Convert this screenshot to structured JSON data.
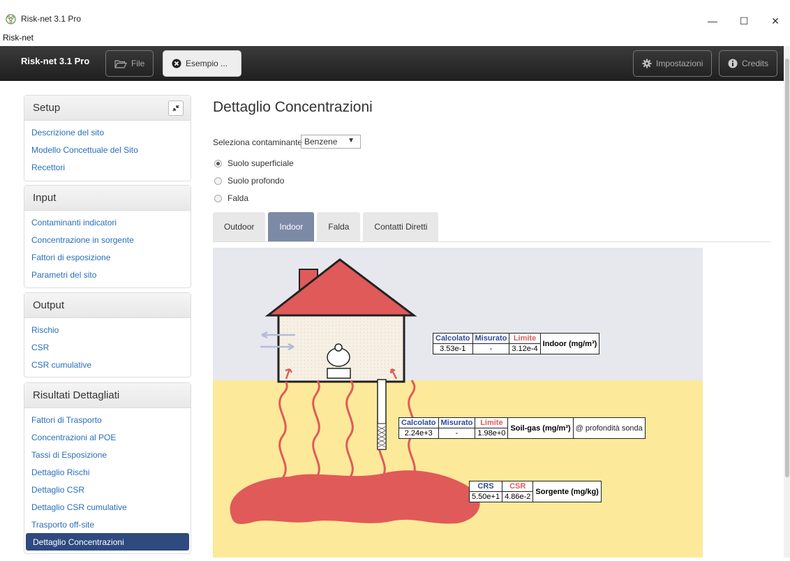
{
  "window": {
    "title": "Risk-net 3.1 Pro",
    "menu": "Risk-net",
    "controls": {
      "minimize": "—",
      "maximize": "☐",
      "close": "✕"
    }
  },
  "navbar": {
    "brand": "Risk-net 3.1 Pro",
    "file_label": "File",
    "esempio_label": "Esempio ...",
    "impostazioni_label": "Impostazioni",
    "credits_label": "Credits"
  },
  "sidebar": {
    "setup": {
      "title": "Setup",
      "items": [
        "Descrizione del sito",
        "Modello Concettuale del Sito",
        "Recettori"
      ]
    },
    "input": {
      "title": "Input",
      "items": [
        "Contaminanti indicatori",
        "Concentrazione in sorgente",
        "Fattori di esposizione",
        "Parametri del sito"
      ]
    },
    "output": {
      "title": "Output",
      "items": [
        "Rischio",
        "CSR",
        "CSR cumulative"
      ]
    },
    "risultati": {
      "title": "Risultati Dettagliati",
      "items": [
        "Fattori di Trasporto",
        "Concentrazioni al POE",
        "Tassi di Esposizione",
        "Dettaglio Rischi",
        "Dettaglio CSR",
        "Dettaglio CSR cumulative",
        "Trasporto off-site",
        "Dettaglio Concentrazioni"
      ],
      "active": "Dettaglio Concentrazioni"
    }
  },
  "main": {
    "title": "Dettaglio Concentrazioni",
    "select_label": "Seleziona contaminante",
    "select_value": "Benzene",
    "radios": [
      {
        "label": "Suolo superficiale",
        "checked": true
      },
      {
        "label": "Suolo profondo",
        "checked": false
      },
      {
        "label": "Falda",
        "checked": false
      }
    ],
    "tabs": [
      "Outdoor",
      "Indoor",
      "Falda",
      "Contatti Diretti"
    ],
    "active_tab": "Indoor"
  },
  "indoor_table": {
    "h_calc": "Calcolato",
    "h_mis": "Misurato",
    "h_lim": "Limite",
    "v_calc": "3.53e-1",
    "v_mis": "-",
    "v_lim": "3.12e-4",
    "label": "Indoor (mg/m³)"
  },
  "soilgas_table": {
    "h_calc": "Calcolato",
    "h_mis": "Misurato",
    "h_lim": "Limite",
    "v_calc": "2.24e+3",
    "v_mis": "-",
    "v_lim": "1.98e+0",
    "label": "Soil-gas (mg/m³)",
    "extra": "@ profondità sonda"
  },
  "source_table": {
    "h_crs": "CRS",
    "h_csr": "CSR",
    "v_crs": "5.50e+1",
    "v_csr": "4.86e-2",
    "label": "Sorgente (mg/kg)"
  },
  "colors": {
    "sky": "#e6e8ee",
    "soil": "#fde99a",
    "source": "#e05a5a",
    "roof": "#e05a5a",
    "nav": "#2e4a7f"
  }
}
